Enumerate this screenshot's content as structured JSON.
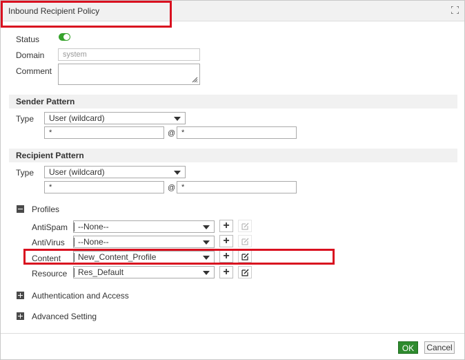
{
  "dialog": {
    "title": "Inbound Recipient Policy"
  },
  "form": {
    "status_label": "Status",
    "status_on": true,
    "domain_label": "Domain",
    "domain_value": "system",
    "comment_label": "Comment",
    "comment_value": ""
  },
  "sender": {
    "heading": "Sender Pattern",
    "type_label": "Type",
    "type_value": "User (wildcard)",
    "user_value": "*",
    "at_symbol": "@",
    "domain_value": "*"
  },
  "recipient": {
    "heading": "Recipient Pattern",
    "type_label": "Type",
    "type_value": "User (wildcard)",
    "user_value": "*",
    "at_symbol": "@",
    "domain_value": "*"
  },
  "profiles": {
    "heading": "Profiles",
    "expanded": true,
    "rows": [
      {
        "label": "AntiSpam",
        "value": "--None--",
        "edit_enabled": false
      },
      {
        "label": "AntiVirus",
        "value": "--None--",
        "edit_enabled": false
      },
      {
        "label": "Content",
        "value": "New_Content_Profile",
        "edit_enabled": true
      },
      {
        "label": "Resource",
        "value": "Res_Default",
        "edit_enabled": true
      }
    ],
    "add_symbol": "+"
  },
  "sections": {
    "auth_label": "Authentication and Access",
    "advanced_label": "Advanced Setting"
  },
  "footer": {
    "ok_label": "OK",
    "cancel_label": "Cancel"
  },
  "colors": {
    "accent_green": "#2e8b2e",
    "toggle_green": "#36a32c",
    "highlight_red": "#d9101f"
  }
}
